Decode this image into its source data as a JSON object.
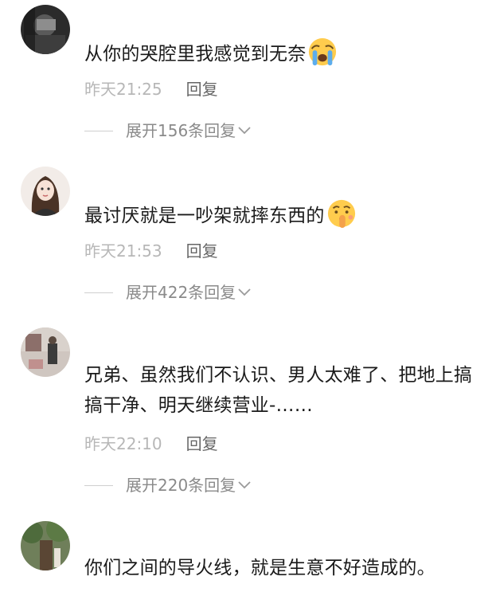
{
  "comments": [
    {
      "text": "从你的哭腔里我感觉到无奈",
      "emoji": "crying-face-icon",
      "time": "昨天21:25",
      "reply_label": "回复",
      "expand_label": "展开156条回复"
    },
    {
      "text": "最讨厌就是一吵架就摔东西的",
      "emoji": "shushing-face-icon",
      "time": "昨天21:53",
      "reply_label": "回复",
      "expand_label": "展开422条回复"
    },
    {
      "text": "兄弟、虽然我们不认识、男人太难了、把地上搞搞干净、明天继续营业-……",
      "emoji": "",
      "time": "昨天22:10",
      "reply_label": "回复",
      "expand_label": "展开220条回复"
    },
    {
      "text": "你们之间的导火线，就是生意不好造成的。",
      "emoji": "",
      "time": "",
      "reply_label": "",
      "expand_label": ""
    }
  ],
  "colors": {
    "meta_gray": "#b7b7b7",
    "reply_gray": "#666666",
    "expand_gray": "#8a8a8a",
    "text": "#1a1a1a"
  }
}
